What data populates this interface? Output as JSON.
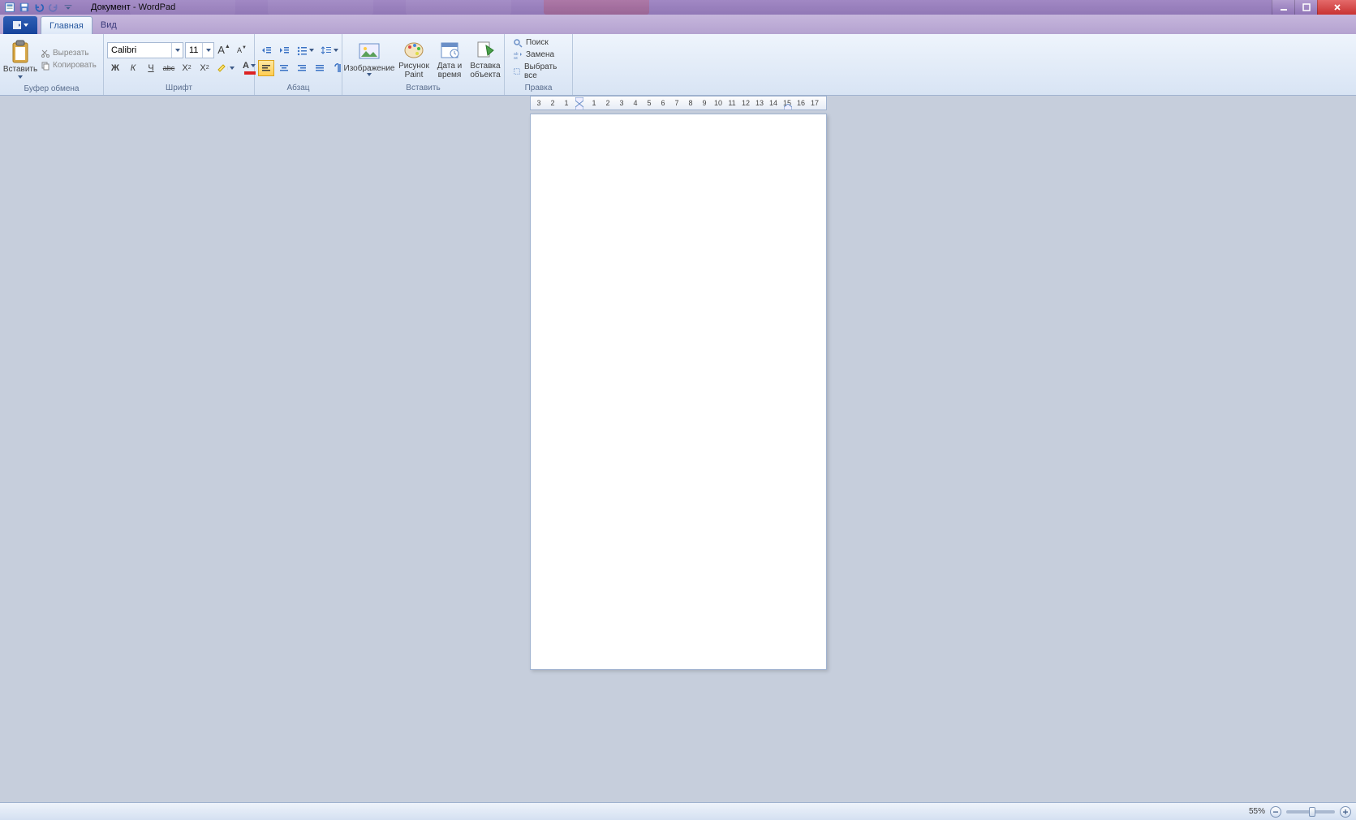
{
  "title": "Документ - WordPad",
  "tabs": {
    "home": "Главная",
    "view": "Вид"
  },
  "clipboard": {
    "paste": "Вставить",
    "cut": "Вырезать",
    "copy": "Копировать",
    "group": "Буфер обмена"
  },
  "font": {
    "family": "Calibri",
    "size": "11",
    "bold": "Ж",
    "italic": "К",
    "underline": "Ч",
    "strike": "abc",
    "sub_base": "X",
    "sub_s": "2",
    "sup_base": "X",
    "sup_s": "2",
    "grow": "A",
    "shrink": "A",
    "group": "Шрифт"
  },
  "paragraph": {
    "group": "Абзац"
  },
  "insert": {
    "image": "Изображение",
    "paint": "Рисунок Paint",
    "datetime": "Дата и время",
    "object": "Вставка объекта",
    "group": "Вставить"
  },
  "editing": {
    "find": "Поиск",
    "replace": "Замена",
    "selectall": "Выбрать все",
    "group": "Правка"
  },
  "ruler": [
    "3",
    "2",
    "1",
    "",
    "1",
    "2",
    "3",
    "4",
    "5",
    "6",
    "7",
    "8",
    "9",
    "10",
    "11",
    "12",
    "13",
    "14",
    "15",
    "16",
    "17"
  ],
  "status": {
    "zoom": "55%"
  }
}
